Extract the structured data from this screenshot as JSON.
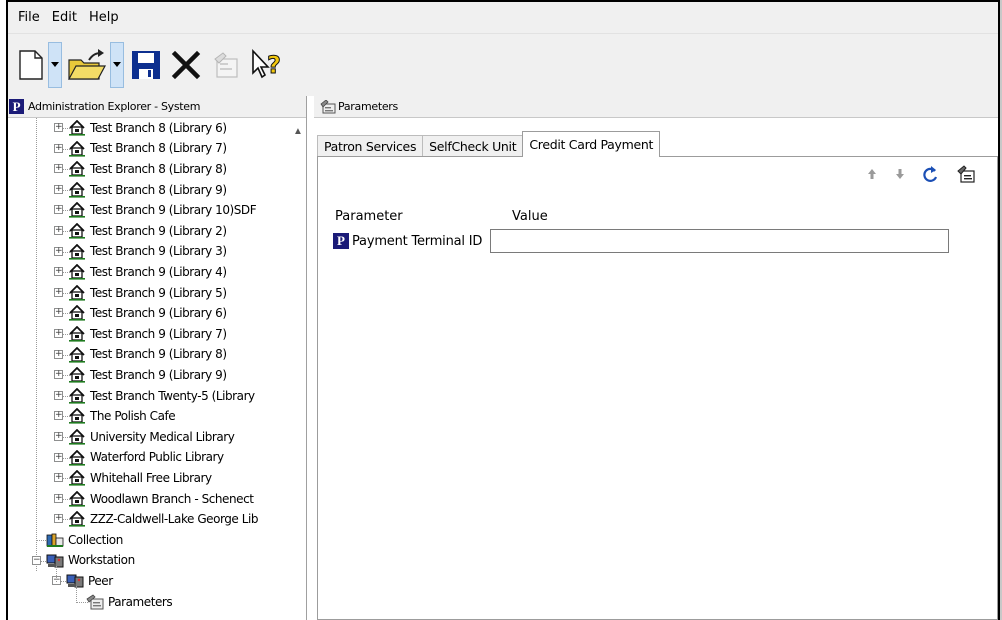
{
  "menu": [
    "File",
    "Edit",
    "Help"
  ],
  "toolbar": {
    "icons": [
      "new-document-icon",
      "open-folder-icon",
      "save-icon",
      "delete-icon",
      "properties-icon",
      "context-help-icon"
    ]
  },
  "left_pane": {
    "title": "Administration Explorer - System",
    "branches": [
      "Test Branch 8 (Library 6)",
      "Test Branch 8 (Library 7)",
      "Test Branch 8 (Library 8)",
      "Test Branch 8 (Library 9)",
      "Test Branch 9 (Library 10)SDF",
      "Test Branch 9 (Library 2)",
      "Test Branch 9 (Library 3)",
      "Test Branch 9 (Library 4)",
      "Test Branch 9 (Library 5)",
      "Test Branch 9 (Library 6)",
      "Test Branch 9 (Library 7)",
      "Test Branch 9 (Library 8)",
      "Test Branch 9 (Library 9)",
      "Test Branch Twenty-5 (Library",
      "The Polish Cafe",
      "University Medical Library",
      "Waterford Public Library",
      "Whitehall Free Library",
      "Woodlawn Branch - Schenect",
      "ZZZ-Caldwell-Lake George Lib"
    ],
    "collection_label": "Collection",
    "workstation_label": "Workstation",
    "peer_label": "Peer",
    "parameters_label": "Parameters"
  },
  "right_pane": {
    "title": "Parameters",
    "tabs": [
      {
        "label": "Patron Services",
        "active": false
      },
      {
        "label": "SelfCheck Unit",
        "active": false
      },
      {
        "label": "Credit Card Payment",
        "active": true
      }
    ],
    "columns": {
      "parameter": "Parameter",
      "value": "Value"
    },
    "row": {
      "parameter": "Payment Terminal ID",
      "value": ""
    }
  },
  "colors": {
    "polaris_logo": "#1b1b78",
    "house_icon": "#1e7a1e",
    "selection_drop": "#cfe3f7"
  }
}
